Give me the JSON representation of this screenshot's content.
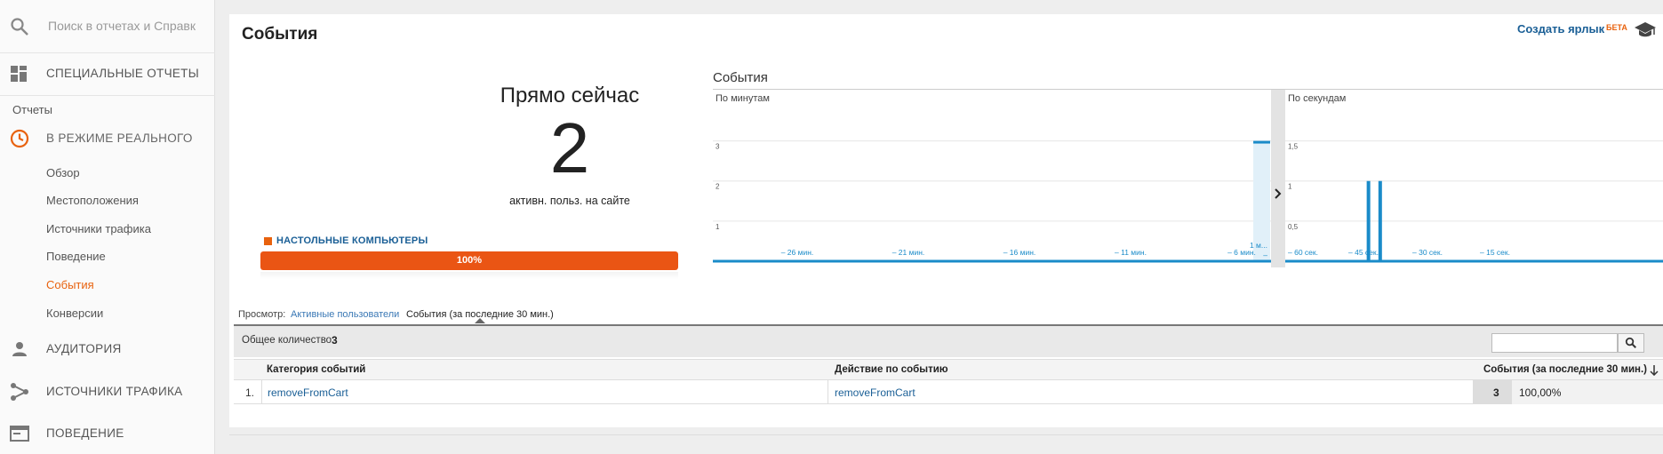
{
  "sidebar": {
    "search_placeholder": "Поиск в отчетах и Справк",
    "custom_reports": "СПЕЦИАЛЬНЫЕ ОТЧЕТЫ",
    "reports_group": "Отчеты",
    "realtime": "В РЕЖИМЕ РЕАЛЬНОГО",
    "realtime_items": [
      "Обзор",
      "Местоположения",
      "Источники трафика",
      "Поведение",
      "События",
      "Конверсии"
    ],
    "active_item": "События",
    "audience": "АУДИТОРИЯ",
    "acquisition": "ИСТОЧНИКИ ТРАФИКА",
    "behavior": "ПОВЕДЕНИЕ"
  },
  "header": {
    "title": "События",
    "shortcut": "Создать ярлык",
    "beta": "БЕТА"
  },
  "right_now": {
    "title": "Прямо сейчас",
    "count": "2",
    "subtitle": "активн. польз. на сайте",
    "device_label": "НАСТОЛЬНЫЕ КОМПЬЮТЕРЫ",
    "device_percent": 100,
    "device_percent_label": "100%"
  },
  "colors": {
    "accent": "#e8620e",
    "bar": "#ea5514",
    "chart": "#1a8bc9",
    "link": "#1a5f96"
  },
  "chart_data": [
    {
      "type": "bar",
      "title": "События",
      "subtitle": "По минутам",
      "ylim": [
        0,
        3.5
      ],
      "y_ticks": [
        "1",
        "2",
        "3"
      ],
      "x_tick_labels": [
        "– 26 мин.",
        "– 21 мин.",
        "– 16 мин.",
        "– 11 мин.",
        "– 6 мин.",
        "1 м...",
        "–"
      ],
      "x": [
        -30,
        -29,
        -28,
        -27,
        -26,
        -25,
        -24,
        -23,
        -22,
        -21,
        -20,
        -19,
        -18,
        -17,
        -16,
        -15,
        -14,
        -13,
        -12,
        -11,
        -10,
        -9,
        -8,
        -7,
        -6,
        -5,
        -4,
        -3,
        -2,
        -1
      ],
      "values": [
        0,
        0,
        0,
        0,
        0,
        0,
        0,
        0,
        0,
        0,
        0,
        0,
        0,
        0,
        0,
        0,
        0,
        0,
        0,
        0,
        0,
        0,
        0,
        0,
        0,
        0,
        0,
        0,
        0,
        3
      ]
    },
    {
      "type": "bar",
      "subtitle": "По секундам",
      "ylim": [
        0,
        1.75
      ],
      "y_ticks": [
        "0,5",
        "1",
        "1,5"
      ],
      "x_tick_labels": [
        "– 60 сек.",
        "– 45 сек.",
        "– 30 сек.",
        "– 15 сек."
      ],
      "spikes_seconds_ago": [
        47,
        45
      ],
      "spike_value": 1
    }
  ],
  "view": {
    "label": "Просмотр:",
    "link": "Активные пользователи",
    "current": "События (за последние 30 мин.)"
  },
  "table": {
    "total_label": "Общее количество:",
    "total_value": "3",
    "headers": [
      "Категория событий",
      "Действие по событию",
      "События (за последние 30 мин.)"
    ],
    "rows": [
      {
        "index": "1.",
        "category": "removeFromCart",
        "action": "removeFromCart",
        "events": "3",
        "percent": "100,00%"
      }
    ]
  }
}
